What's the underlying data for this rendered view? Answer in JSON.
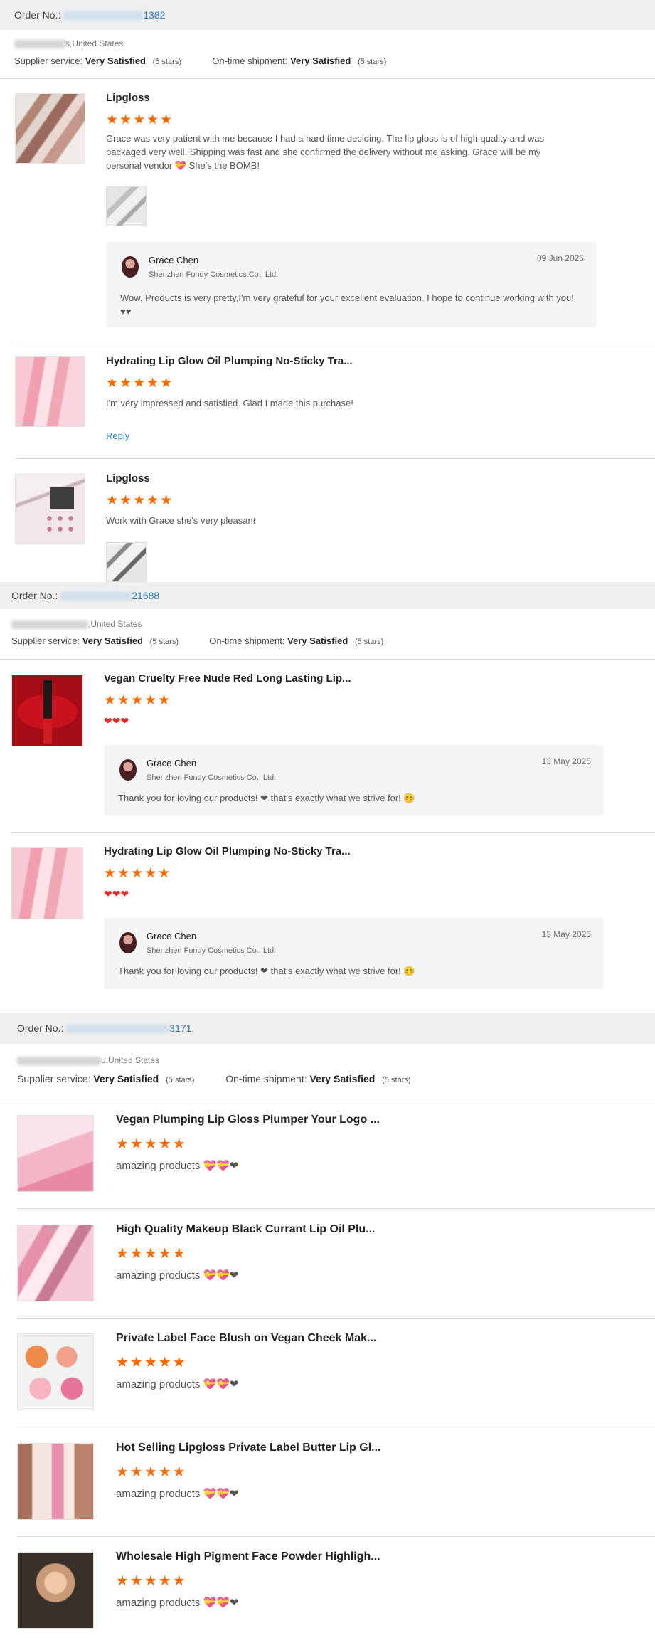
{
  "orders": [
    {
      "order_label": "Order No.:",
      "order_suffix": "1382",
      "location": "s,United States",
      "supplier_label": "Supplier service:",
      "supplier_value": "Very Satisfied",
      "supplier_stars": "(5 stars)",
      "shipment_label": "On-time shipment:",
      "shipment_value": "Very Satisfied",
      "shipment_stars": "(5 stars)",
      "items": [
        {
          "title": "Lipgloss",
          "stars": "★★★★★",
          "text": "Grace was very patient with me because I had a hard time deciding. The lip gloss is of high quality and was packaged very well. Shipping was fast and she confirmed the delivery without me asking. Grace will be my personal vendor 💝 She's the BOMB!",
          "reply": {
            "name": "Grace Chen",
            "company": "Shenzhen Fundy Cosmetics Co., Ltd.",
            "date": "09 Jun 2025",
            "message": "Wow, Products is very pretty,I'm very grateful for your excellent evaluation. I hope to continue working with you!♥♥"
          }
        },
        {
          "title": "Hydrating Lip Glow Oil Plumping No-Sticky Tra...",
          "stars": "★★★★★",
          "text": "I'm very impressed and satisfied. Glad I made this purchase!",
          "reply_link": "Reply"
        },
        {
          "title": "Lipgloss",
          "stars": "★★★★★",
          "text": "Work with Grace she's very pleasant"
        }
      ]
    },
    {
      "order_label": "Order No.:",
      "order_suffix": "21688",
      "location": ",United States",
      "supplier_label": "Supplier service:",
      "supplier_value": "Very Satisfied",
      "supplier_stars": "(5 stars)",
      "shipment_label": "On-time shipment:",
      "shipment_value": "Very Satisfied",
      "shipment_stars": "(5 stars)",
      "items": [
        {
          "title": "Vegan Cruelty Free Nude Red Long Lasting Lip...",
          "stars": "★★★★★",
          "text": "❤❤❤",
          "reply": {
            "name": "Grace Chen",
            "company": "Shenzhen Fundy Cosmetics Co., Ltd.",
            "date": "13 May 2025",
            "message": "Thank you for loving our products! ❤ that's exactly what we strive for! 😊"
          }
        },
        {
          "title": "Hydrating Lip Glow Oil Plumping No-Sticky Tra...",
          "stars": "★★★★★",
          "text": "❤❤❤",
          "reply": {
            "name": "Grace Chen",
            "company": "Shenzhen Fundy Cosmetics Co., Ltd.",
            "date": "13 May 2025",
            "message": "Thank you for loving our products! ❤ that's exactly what we strive for! 😊"
          }
        }
      ]
    },
    {
      "order_label": "Order No.:",
      "order_suffix": "3171",
      "location": "u,United States",
      "supplier_label": "Supplier service:",
      "supplier_value": "Very Satisfied",
      "supplier_stars": "(5 stars)",
      "shipment_label": "On-time shipment:",
      "shipment_value": "Very Satisfied",
      "shipment_stars": "(5 stars)",
      "items": [
        {
          "title": "Vegan Plumping Lip Gloss Plumper Your Logo ...",
          "stars": "★★★★★",
          "text": "amazing products 💝💝❤"
        },
        {
          "title": "High Quality Makeup Black Currant Lip Oil Plu...",
          "stars": "★★★★★",
          "text": "amazing products 💝💝❤"
        },
        {
          "title": "Private Label Face Blush on Vegan Cheek Mak...",
          "stars": "★★★★★",
          "text": "amazing products 💝💝❤"
        },
        {
          "title": "Hot Selling Lipgloss Private Label Butter Lip Gl...",
          "stars": "★★★★★",
          "text": "amazing products 💝💝❤"
        },
        {
          "title": "Wholesale High Pigment Face Powder Highligh...",
          "stars": "★★★★★",
          "text": "amazing products 💝💝❤"
        }
      ]
    }
  ],
  "colors": {
    "accent_link": "#2a7ab8",
    "stars": "#ff6a00",
    "heart": "#e02a2a",
    "header_bg": "#efefef"
  }
}
